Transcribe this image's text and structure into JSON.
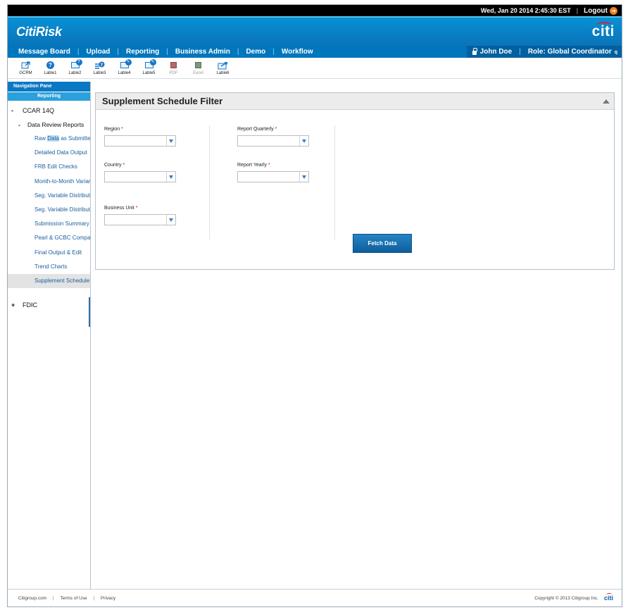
{
  "status": {
    "datetime": "Wed, Jan 20 2014 2:45:30 EST",
    "logout_label": "Logout"
  },
  "brand": {
    "app_title": "CitiRisk",
    "logo_text": "citi"
  },
  "nav": {
    "items": [
      {
        "label": "Message Board"
      },
      {
        "label": "Upload"
      },
      {
        "label": "Reporting"
      },
      {
        "label": "Business Admin"
      },
      {
        "label": "Demo"
      },
      {
        "label": "Workflow"
      }
    ],
    "user": "John Doe",
    "role": "Role: Global Coordinator"
  },
  "toolbar": {
    "tools": [
      {
        "label": "GCRM",
        "icon": "export-icon"
      },
      {
        "label": "Lable1",
        "icon": "help-icon"
      },
      {
        "label": "Lable2",
        "icon": "help-window-icon"
      },
      {
        "label": "Lable3",
        "icon": "list-help-icon"
      },
      {
        "label": "Lable4",
        "icon": "edit-window-icon"
      },
      {
        "label": "Lable5",
        "icon": "edit-window-icon"
      },
      {
        "label": "PDF",
        "icon": "pdf-icon"
      },
      {
        "label": "Excel",
        "icon": "excel-icon"
      },
      {
        "label": "Lable6",
        "icon": "send-window-icon"
      }
    ]
  },
  "left_pane": {
    "header": "Navigation Pane",
    "section": "Reporting",
    "root": {
      "toggle": "-",
      "label": "CCAR 14Q"
    },
    "group": {
      "toggle": "-",
      "label": "Data Review Reports"
    },
    "items": [
      {
        "label_pre": "Raw ",
        "label_hl": "Data",
        "label_post": " as Submitted"
      },
      {
        "label": "Detailed Data Output"
      },
      {
        "label": "FRB Edit Checks"
      },
      {
        "label": "Month-to-Month Variance"
      },
      {
        "label": "Seg. Variable Distribution"
      },
      {
        "label": "Seg. Variable Distribution"
      },
      {
        "label": "Submission Summary"
      },
      {
        "label": "Pearl & GCBC Comparison"
      },
      {
        "label": "Final Output & Edit"
      },
      {
        "label": "Trend Charts"
      },
      {
        "label": "Supplement Schedule"
      }
    ],
    "other_root": {
      "toggle": "+",
      "label": "FDIC"
    }
  },
  "panel": {
    "title": "Supplement Schedule Filter",
    "fields": {
      "region": {
        "label": "Region",
        "value": ""
      },
      "country": {
        "label": "Country",
        "value": ""
      },
      "business_unit": {
        "label": "Business Unit",
        "value": ""
      },
      "report_quarterly": {
        "label": "Report Quarterly",
        "value": ""
      },
      "report_yearly": {
        "label": "Report Yearly",
        "value": ""
      }
    },
    "required_mark": "*",
    "fetch_label": "Fetch Data"
  },
  "footer": {
    "links": [
      "Citigroup.com",
      "Terms of Use",
      "Privacy"
    ],
    "copyright": "Copyright © 2013 Citigroup Inc."
  },
  "colors": {
    "brand_blue": "#0a73b8",
    "nav_blue": "#0076bd",
    "accent_cyan": "#4bc6f0",
    "required_red": "#d0021b",
    "logout_orange": "#f07e1a"
  }
}
